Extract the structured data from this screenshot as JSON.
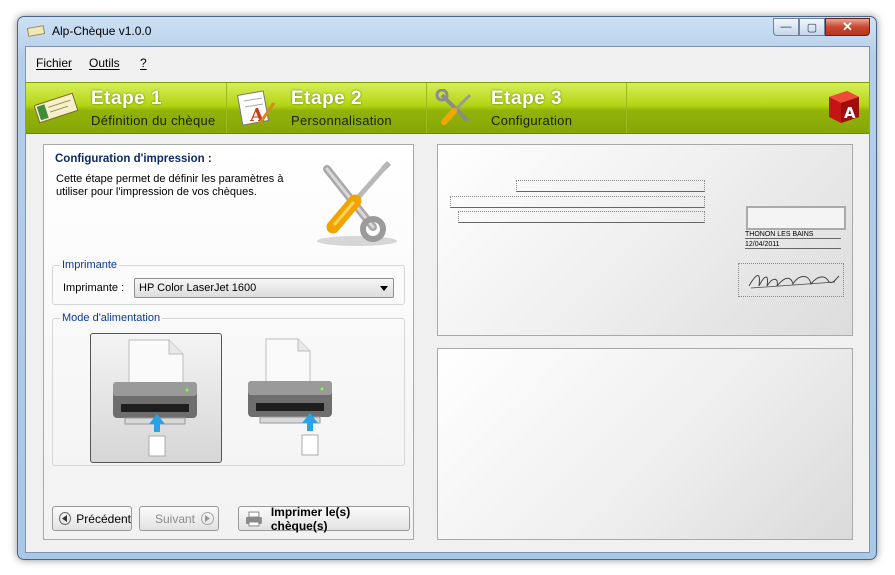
{
  "window": {
    "title": "Alp-Chèque v1.0.0",
    "minimize": "—",
    "maximize": "▢",
    "close": "✕"
  },
  "menu": [
    {
      "label": "Fichier"
    },
    {
      "label": "Outils"
    },
    {
      "label": "?"
    }
  ],
  "steps": [
    {
      "number": "Etape 1",
      "description": "Définition du chèque",
      "icon": "cheque-icon"
    },
    {
      "number": "Etape 2",
      "description": "Personnalisation",
      "icon": "customize-icon"
    },
    {
      "number": "Etape 3",
      "description": "Configuration",
      "icon": "tools-icon"
    }
  ],
  "config": {
    "title": "Configuration d'impression :",
    "description": "Cette étape permet de définir les paramètres à utiliser pour l'impression de vos chèques."
  },
  "printer_group": {
    "label": "Imprimante",
    "field_label": "Imprimante :",
    "selected": "HP Color LaserJet 1600"
  },
  "feed_group": {
    "label": "Mode d'alimentation",
    "selected_index": 0
  },
  "buttons": {
    "previous": "Précédent",
    "next": "Suivant",
    "print": "Imprimer le(s) chèque(s)"
  },
  "cheque": {
    "city": "THONON LES BAINS",
    "date": "12/04/2011"
  },
  "colors": {
    "accent_green": "#b4d414",
    "title_blue": "#0e2a6b",
    "group_blue": "#0b3b9a",
    "logo_red": "#d01a1a"
  }
}
